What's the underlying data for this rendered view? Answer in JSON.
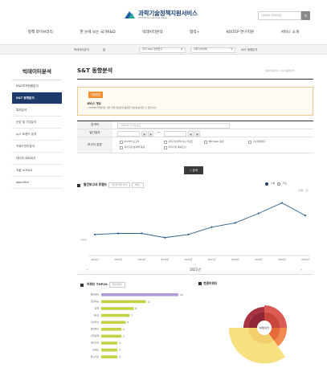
{
  "header": {
    "logo_title": "과학기술정책지원서비스",
    "logo_subtitle": "KISTEP Knowledge Base",
    "search_placeholder": "검색어를 입력하세요",
    "search_icon": "search-icon"
  },
  "gnb": [
    "정책 라이브러리",
    "한 눈에 보는 국가R&D",
    "빅데이터분석",
    "협력+",
    "KISTEP 연구지원",
    "서비스 소개"
  ],
  "subbar": {
    "prefix": "빅데이터분석",
    "home": "홈",
    "select1": "국가 R&D 정책연구",
    "select2": "과학기술정책",
    "select3": "S&T 동향분석"
  },
  "side": {
    "title": "빅데이터분석",
    "items": [
      "R&D투자현황분석",
      "S&T 동향분석",
      "특허분석",
      "산업 및 기업분석",
      "뉴스 트렌드 분석",
      "키워드연도분석",
      "데이터 네트워크",
      "지출 in R&D",
      "sporkfire"
    ],
    "active_index": 1
  },
  "main": {
    "title": "S&T 동향분석",
    "breadcrumb": "빅데이터분석 > S&T 동향분석",
    "notice_tab": "이용방법",
    "notice_heading": "서비스 개요",
    "notice_text": "• KISTEP 빅데이터 기반 과학기술정책 동향을 한눈에 분석할 수 있습니다."
  },
  "form": {
    "row1_label": "검색어",
    "row1_placeholder": "검색어를 입력하세요",
    "row2_label": "발간일자",
    "date_sep": "~",
    "row3_label": "보고서 분류",
    "categories": [
      "KISTEP 보고서",
      "과학기술정책 이슈 리포트",
      "해외 R&D 동향",
      "기술영향평가",
      "과학기술 분야별 동향",
      "과학기술 예측조사",
      "국가R&D 사업 평가"
    ],
    "search_button": "검색"
  },
  "trend": {
    "title": "발간보고서 트렌드",
    "pill1": "연도별 발간 추이",
    "pill2": "키워드",
    "option_all": "전체",
    "option_year": "연도",
    "unit": "(단위 : 건)"
  },
  "year_nav": {
    "prev": "‹",
    "year": "2021년",
    "next": "›"
  },
  "keywords": {
    "title": "키워드 TOP10",
    "pill": "연관검색어",
    "labels": [
      "빅데이터",
      "인공지능",
      "정책",
      "R&D",
      "기술혁신",
      "협력연구",
      "산업정책",
      "과학기술",
      "데이터",
      "연구기관"
    ],
    "values": [
      19,
      11,
      8,
      7,
      6,
      5,
      5,
      4,
      4,
      4
    ]
  },
  "related": {
    "title": "연관키워드",
    "center": "빅데이터"
  },
  "chart_data": {
    "type": "line",
    "x": [
      "2012년",
      "2013년",
      "2014년",
      "2015년",
      "2016년",
      "2017년",
      "2018년",
      "2019년",
      "2020년",
      "2021년"
    ],
    "series": [
      {
        "values": [
          1005,
          1006,
          1006,
          1002,
          1005,
          1012,
          1016,
          1025,
          1035,
          1023
        ]
      }
    ],
    "yticks": [
      1000
    ],
    "ylim": [
      985,
      1040
    ],
    "xlabel": "",
    "ylabel": "",
    "grid": false,
    "color": "#2b5f8a"
  }
}
